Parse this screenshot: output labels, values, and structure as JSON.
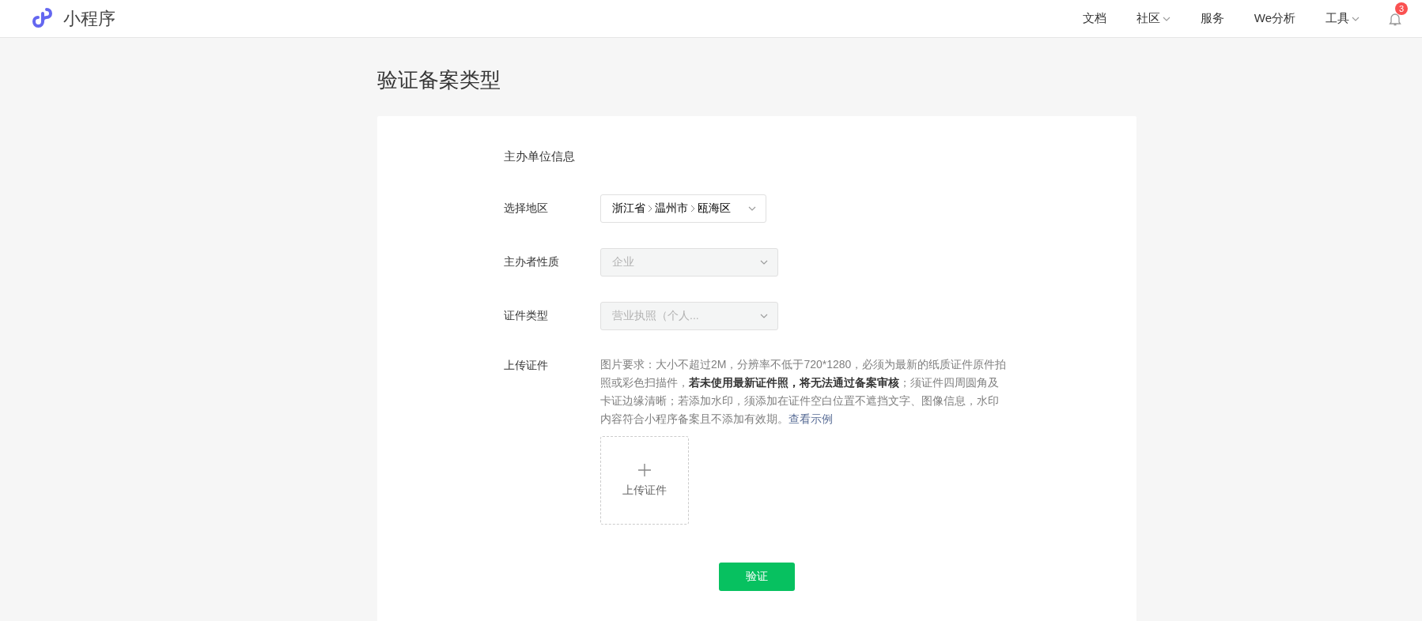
{
  "header": {
    "logo_text": "小程序",
    "nav": [
      {
        "label": "文档",
        "dropdown": false
      },
      {
        "label": "社区",
        "dropdown": true
      },
      {
        "label": "服务",
        "dropdown": false
      },
      {
        "label": "We分析",
        "dropdown": false
      },
      {
        "label": "工具",
        "dropdown": true
      }
    ],
    "notification_badge": "3"
  },
  "page_title": "验证备案类型",
  "section_title": "主办单位信息",
  "fields": [
    {
      "label": "选择地区",
      "kind": "cascader",
      "parts": [
        "浙江省",
        "温州市",
        "瓯海区"
      ],
      "disabled": false
    },
    {
      "label": "主办者性质",
      "kind": "select",
      "value": "企业",
      "disabled": true
    },
    {
      "label": "证件类型",
      "kind": "select",
      "value": "营业执照（个人...",
      "disabled": true
    }
  ],
  "upload": {
    "label": "上传证件",
    "requirement": "图片要求：大小不超过2M，分辨率不低于720*1280，必须为最新的纸质证件原件拍照或彩色扫描件，**若未使用最新证件照，将无法通过备案审核**；须证件四周圆角及卡证边缘清晰；若添加水印，须添加在证件空白位置不遮挡文字、图像信息，水印内容符合小程序备案且不添加有效期。",
    "link": "查看示例",
    "button_label": "上传证件"
  },
  "submit_label": "验证"
}
